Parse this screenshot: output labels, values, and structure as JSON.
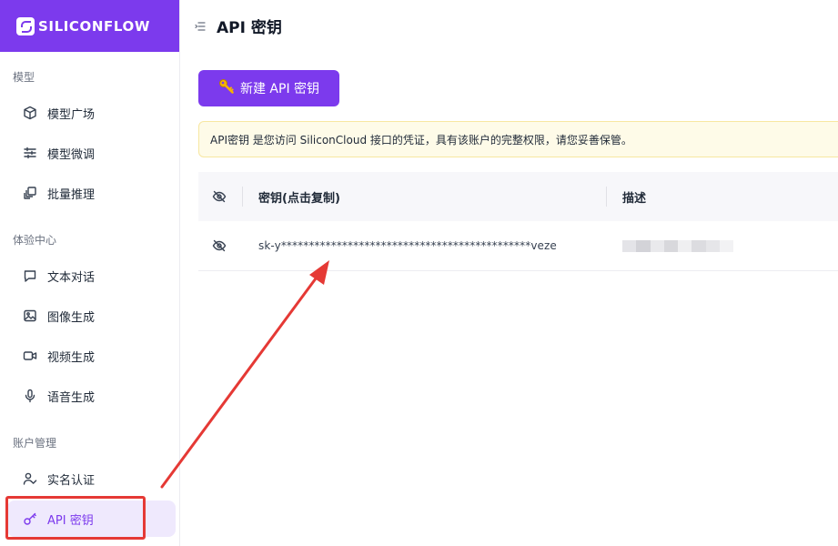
{
  "brand": {
    "name": "SILICONFLOW",
    "color": "#7c3aed"
  },
  "sidebar": {
    "sections": [
      {
        "label": "模型",
        "items": [
          {
            "label": "模型广场",
            "icon": "cube-icon"
          },
          {
            "label": "模型微调",
            "icon": "sliders-icon"
          },
          {
            "label": "批量推理",
            "icon": "layers-icon"
          }
        ]
      },
      {
        "label": "体验中心",
        "items": [
          {
            "label": "文本对话",
            "icon": "chat-bubble-icon"
          },
          {
            "label": "图像生成",
            "icon": "image-icon"
          },
          {
            "label": "视频生成",
            "icon": "video-camera-icon"
          },
          {
            "label": "语音生成",
            "icon": "microphone-icon"
          }
        ]
      },
      {
        "label": "账户管理",
        "items": [
          {
            "label": "实名认证",
            "icon": "user-check-icon"
          },
          {
            "label": "API 密钥",
            "icon": "key-icon",
            "active": true
          }
        ]
      }
    ]
  },
  "header": {
    "title": "API 密钥"
  },
  "main": {
    "new_key_button": "新建 API 密钥",
    "notice": "API密钥 是您访问 SiliconCloud 接口的凭证，具有该账户的完整权限，请您妥善保管。",
    "table": {
      "columns": {
        "key": "密钥(点击复制)",
        "description": "描述"
      },
      "rows": [
        {
          "key": "sk-y*********************************************veze",
          "description": ""
        }
      ]
    }
  },
  "annotation": {
    "color": "#e53935"
  }
}
